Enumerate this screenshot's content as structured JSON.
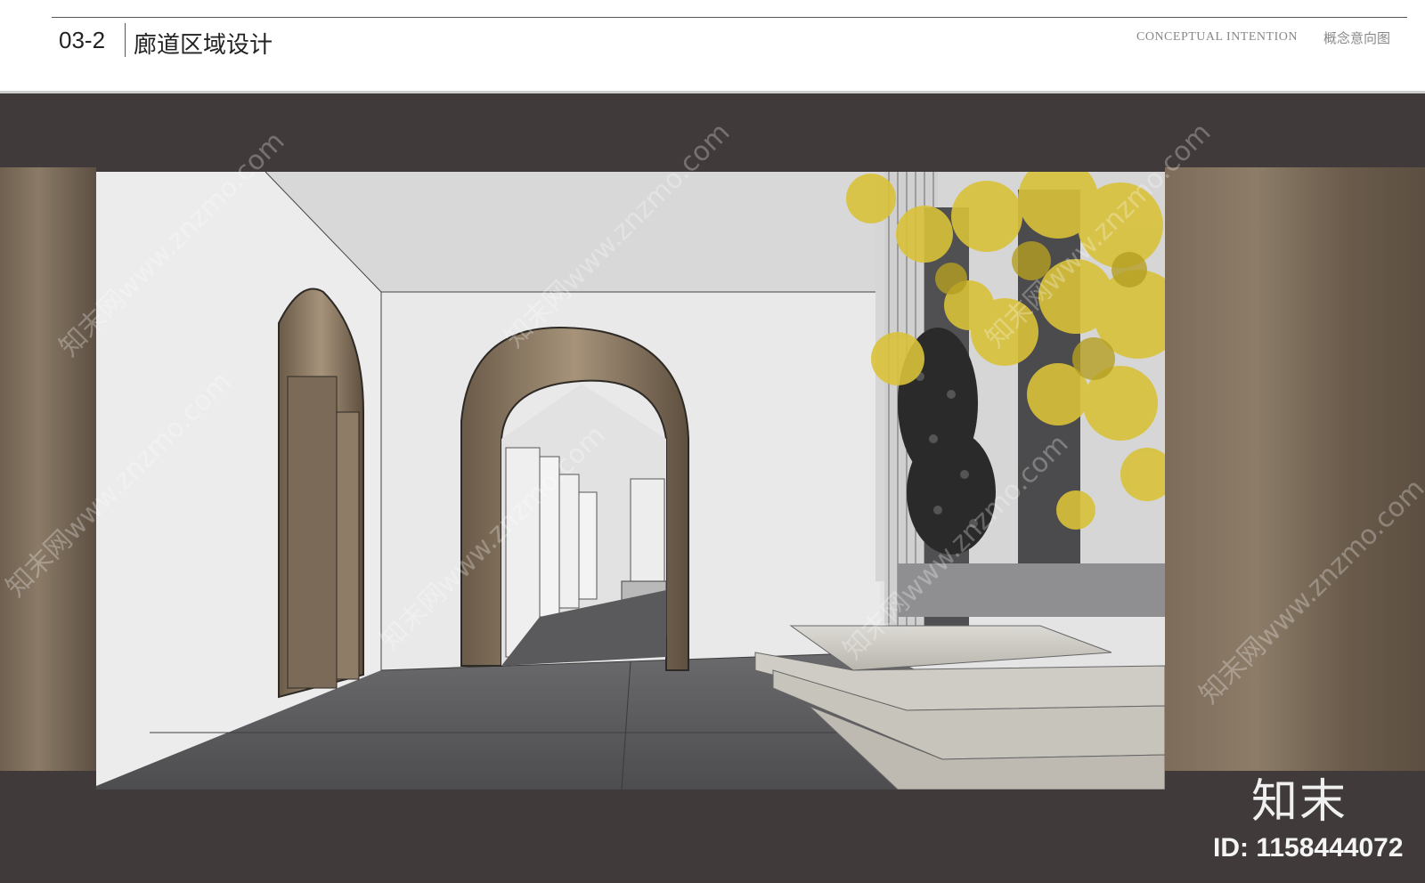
{
  "header": {
    "section_number": "03-2",
    "section_title": "廊道区域设计",
    "concept_en": "CONCEPTUAL  INTENTION",
    "concept_cn": "概念意向图"
  },
  "watermark": {
    "text": "知末网www.znzmo.com",
    "logo": "知末",
    "id_label": "ID: 1158444072"
  },
  "colors": {
    "stage_dark": "#403b3a",
    "bronze": "#7d6c5a",
    "wall": "#e8e8e8",
    "floor": "#5e5e60",
    "foliage": "#d9c23a"
  },
  "render": {
    "icon": "corridor-rendering-image"
  }
}
